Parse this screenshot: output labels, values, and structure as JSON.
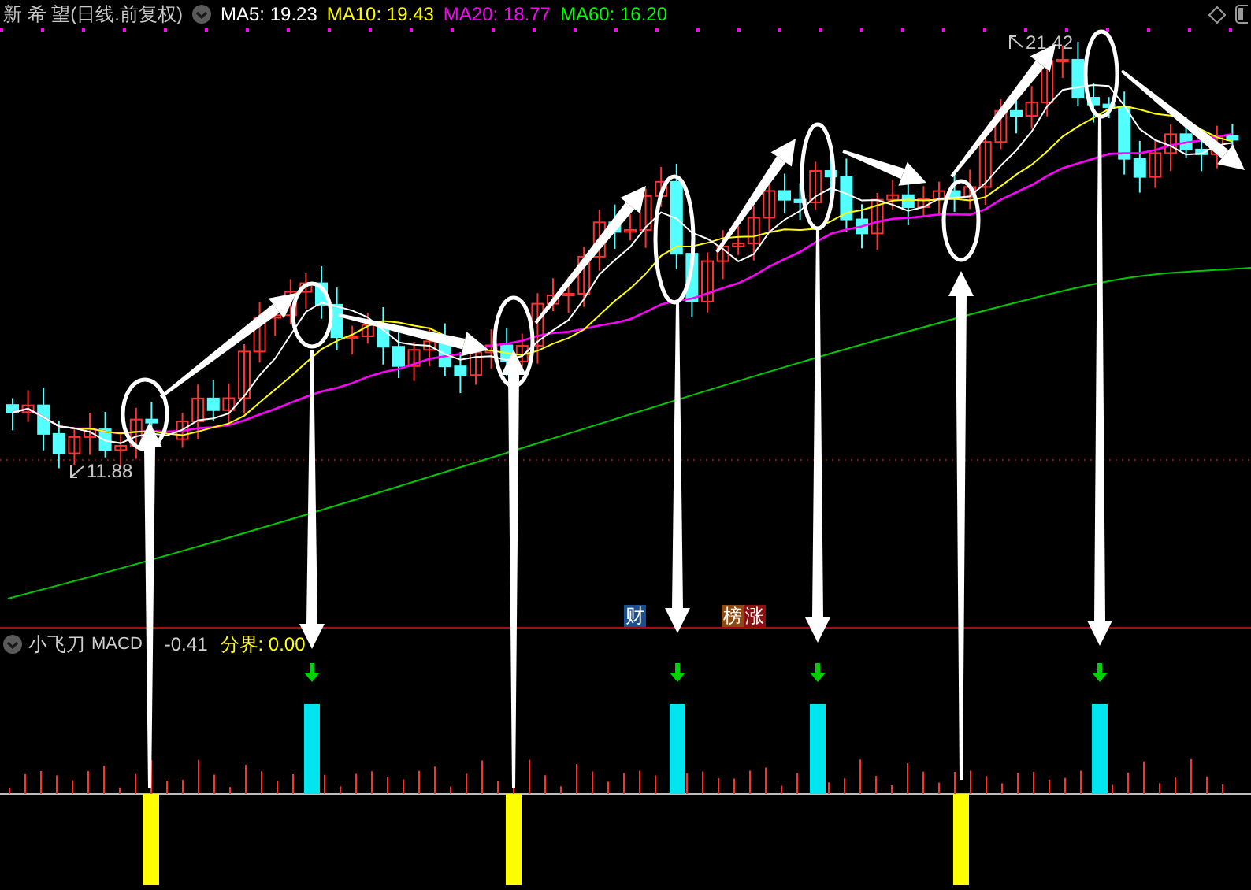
{
  "header": {
    "title": "新 希 望(日线.前复权)",
    "ma": [
      {
        "label": "MA5: 19.23",
        "color": "#ffffff"
      },
      {
        "label": "MA10: 19.43",
        "color": "#ffff00"
      },
      {
        "label": "MA20: 18.77",
        "color": "#ff00ff"
      },
      {
        "label": "MA60: 16.20",
        "color": "#00ff00"
      }
    ]
  },
  "chart": {
    "high_label": "21.42",
    "low_label": "11.88",
    "badges": [
      {
        "text": "财",
        "color": "#1c4f8f"
      },
      {
        "text": "榜",
        "color": "#8a4a12"
      },
      {
        "text": "涨",
        "color": "#8a0f0f"
      }
    ]
  },
  "indicator": {
    "name": "小飞刀",
    "macd_label": "MACD",
    "macd_value": "-0.41",
    "divider": "分界: 0.00"
  }
}
